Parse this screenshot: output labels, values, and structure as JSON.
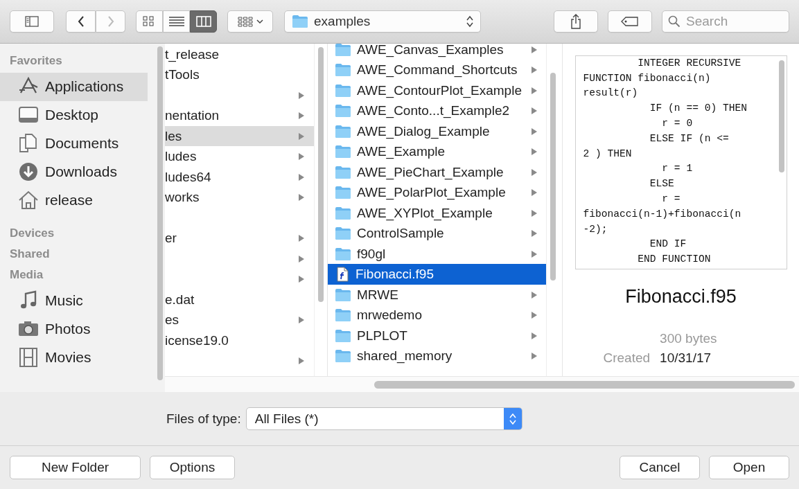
{
  "toolbar": {
    "view_modes": [
      {
        "kind": "icons",
        "selected": false
      },
      {
        "kind": "list",
        "selected": false
      },
      {
        "kind": "columns",
        "selected": true
      }
    ],
    "path": {
      "folder": "examples"
    },
    "search": {
      "placeholder": "Search"
    }
  },
  "sidebar": {
    "sections": [
      {
        "title": "Favorites",
        "items": [
          {
            "label": "Applications",
            "kind": "apps",
            "selected": true
          },
          {
            "label": "Desktop",
            "kind": "desktop",
            "selected": false
          },
          {
            "label": "Documents",
            "kind": "documents",
            "selected": false
          },
          {
            "label": "Downloads",
            "kind": "downloads",
            "selected": false
          },
          {
            "label": "release",
            "kind": "home",
            "selected": false
          }
        ]
      },
      {
        "title": "Devices"
      },
      {
        "title": "Shared"
      },
      {
        "title": "Media",
        "items": [
          {
            "label": "Music",
            "kind": "music",
            "selected": false
          },
          {
            "label": "Photos",
            "kind": "photos",
            "selected": false
          },
          {
            "label": "Movies",
            "kind": "movies",
            "selected": false
          }
        ]
      }
    ]
  },
  "column_1": {
    "rows": [
      {
        "label": "t_release",
        "arrow": false,
        "selected": false
      },
      {
        "label": "tTools",
        "arrow": false,
        "selected": false
      },
      {
        "arrow": true,
        "selected": false
      },
      {
        "label": "nentation",
        "arrow": true,
        "selected": false
      },
      {
        "label": "les",
        "arrow": true,
        "selected": true
      },
      {
        "label": "ludes",
        "arrow": true,
        "selected": false
      },
      {
        "label": "ludes64",
        "arrow": true,
        "selected": false
      },
      {
        "label": "works",
        "arrow": true,
        "selected": false
      },
      {
        "arrow": false,
        "selected": false
      },
      {
        "label": "er",
        "arrow": true,
        "selected": false
      },
      {
        "arrow": true,
        "selected": false
      },
      {
        "arrow": true,
        "selected": false
      },
      {
        "label": "e.dat",
        "arrow": false,
        "selected": false
      },
      {
        "label": "es",
        "arrow": true,
        "selected": false
      },
      {
        "label": "icense19.0",
        "arrow": false,
        "selected": false
      },
      {
        "arrow": true,
        "selected": false
      }
    ]
  },
  "column_2": {
    "rows": [
      {
        "label": "AWE_Canvas_Examples",
        "kind": "folder",
        "selected": false
      },
      {
        "label": "AWE_Command_Shortcuts",
        "kind": "folder",
        "selected": false
      },
      {
        "label": "AWE_ContourPlot_Example",
        "kind": "folder",
        "selected": false
      },
      {
        "label": "AWE_Conto...t_Example2",
        "kind": "folder",
        "selected": false
      },
      {
        "label": "AWE_Dialog_Example",
        "kind": "folder",
        "selected": false
      },
      {
        "label": "AWE_Example",
        "kind": "folder",
        "selected": false
      },
      {
        "label": "AWE_PieChart_Example",
        "kind": "folder",
        "selected": false
      },
      {
        "label": "AWE_PolarPlot_Example",
        "kind": "folder",
        "selected": false
      },
      {
        "label": "AWE_XYPlot_Example",
        "kind": "folder",
        "selected": false
      },
      {
        "label": "ControlSample",
        "kind": "folder",
        "selected": false
      },
      {
        "label": "f90gl",
        "kind": "folder",
        "selected": false
      },
      {
        "label": "Fibonacci.f95",
        "kind": "file",
        "selected": true
      },
      {
        "label": "MRWE",
        "kind": "folder",
        "selected": false
      },
      {
        "label": "mrwedemo",
        "kind": "folder",
        "selected": false
      },
      {
        "label": "PLPLOT",
        "kind": "folder",
        "selected": false
      },
      {
        "label": "shared_memory",
        "kind": "folder",
        "selected": false
      }
    ]
  },
  "preview": {
    "code_lines": [
      "         INTEGER RECURSIVE",
      "FUNCTION fibonacci(n)",
      "result(r)",
      "           IF (n == 0) THEN",
      "             r = 0",
      "           ELSE IF (n <=",
      "2 ) THEN",
      "             r = 1",
      "           ELSE",
      "             r =",
      "fibonacci(n-1)+fibonacci(n",
      "-2);",
      "           END IF",
      "         END FUNCTION"
    ],
    "filename": "Fibonacci.f95",
    "size": "300 bytes",
    "created": {
      "label": "Created",
      "value": "10/31/17"
    }
  },
  "file_type": {
    "label": "Files of type:",
    "value": "All Files (*)"
  },
  "buttons_left": [
    "New Folder",
    "Options"
  ],
  "buttons_right": [
    "Cancel",
    "Open"
  ]
}
